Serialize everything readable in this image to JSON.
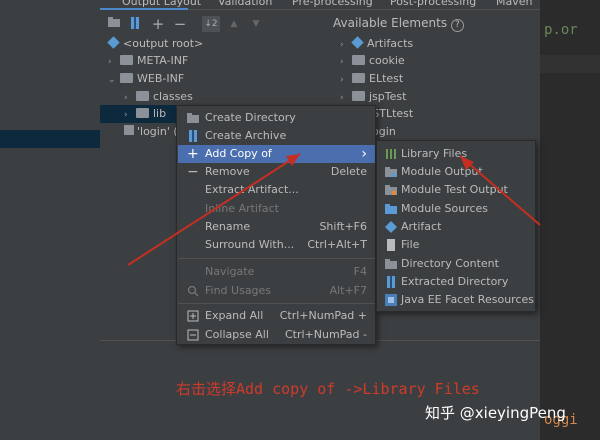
{
  "tabs": [
    "Output Layout",
    "Validation",
    "Pre-processing",
    "Post-processing",
    "Maven"
  ],
  "toolbar": {
    "icons": [
      "folder-icon",
      "archive-icon",
      "add-icon",
      "remove-icon",
      "sort-icon",
      "up-icon",
      "down-icon"
    ],
    "add": "+",
    "remove": "−",
    "sort": "↓2",
    "up": "▲",
    "down": "▼"
  },
  "tree": {
    "output_root": "<output root>",
    "meta_inf": "META-INF",
    "web_inf": "WEB-INF",
    "classes": "classes",
    "lib": "lib",
    "login": "'login' (",
    "arrow_right": "›",
    "arrow_down": "⌄"
  },
  "available": {
    "title": "Available Elements",
    "help": "?",
    "items": [
      "Artifacts",
      "cookie",
      "ELtest",
      "jspTest",
      "JSTLtest",
      "login"
    ]
  },
  "context_menu": {
    "items": [
      {
        "label": "Create Directory",
        "shortcut": ""
      },
      {
        "label": "Create Archive",
        "shortcut": ""
      },
      {
        "label": "Add Copy of",
        "shortcut": "›"
      },
      {
        "label": "Remove",
        "shortcut": "Delete"
      },
      {
        "label": "Extract Artifact...",
        "shortcut": ""
      },
      {
        "label": "Inline Artifact",
        "shortcut": ""
      },
      {
        "label": "Rename",
        "shortcut": "Shift+F6"
      },
      {
        "label": "Surround With...",
        "shortcut": "Ctrl+Alt+T"
      },
      {
        "label": "Navigate",
        "shortcut": "F4"
      },
      {
        "label": "Find Usages",
        "shortcut": "Alt+F7"
      },
      {
        "label": "Expand All",
        "shortcut": "Ctrl+NumPad +"
      },
      {
        "label": "Collapse All",
        "shortcut": "Ctrl+NumPad -"
      }
    ]
  },
  "submenu": {
    "items": [
      "Library Files",
      "Module Output",
      "Module Test Output",
      "Module Sources",
      "Artifact",
      "File",
      "Directory Content",
      "Extracted Directory",
      "Java EE Facet Resources"
    ]
  },
  "editor": {
    "line1": "p.or",
    "line2": "oggi"
  },
  "annotation": "右击选择Add copy of ->Library Files",
  "watermark": "知乎 @xieyingPeng",
  "colors": {
    "highlight": "#4b6eaf",
    "annotation": "#d03a2a",
    "selection": "#0d293e"
  }
}
